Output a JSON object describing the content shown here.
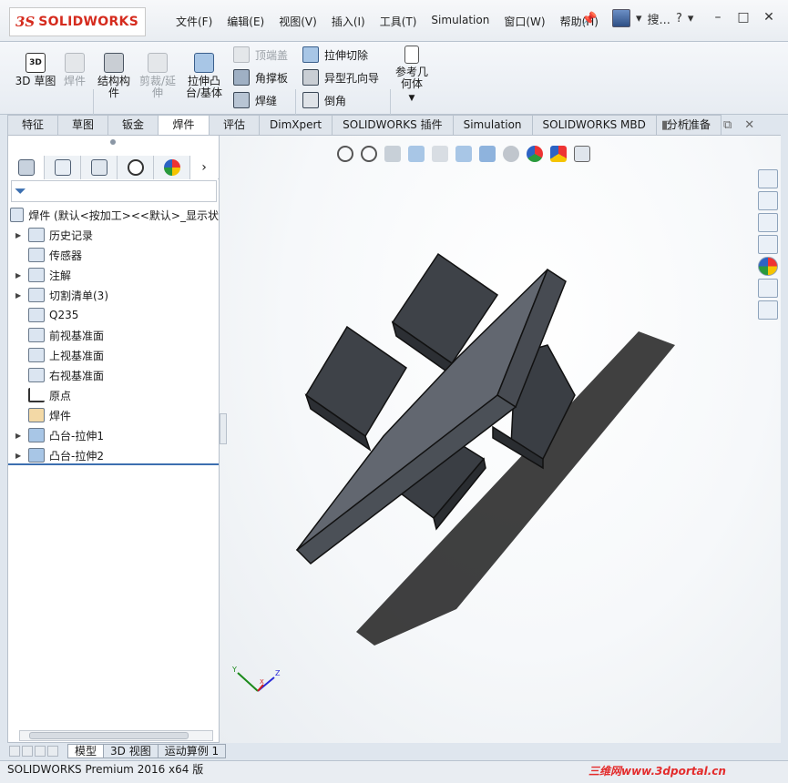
{
  "titlebar": {
    "logo_prefix": "3S",
    "logo_text": "SOLIDWORKS",
    "menus": [
      "文件(F)",
      "编辑(E)",
      "视图(V)",
      "插入(I)",
      "工具(T)",
      "Simulation",
      "窗口(W)",
      "帮助(H)"
    ],
    "right_label": "搜...",
    "help": "?"
  },
  "command_manager": {
    "left_buttons": [
      {
        "label": "3D 草图",
        "disabled": false
      },
      {
        "label": "焊件",
        "disabled": true
      },
      {
        "label": "结构构件",
        "disabled": false
      },
      {
        "label": "剪裁/延伸",
        "disabled": true
      },
      {
        "label": "拉伸凸台/基体",
        "disabled": false
      }
    ],
    "col1": [
      {
        "label": "顶端盖",
        "disabled": true
      },
      {
        "label": "角撑板",
        "disabled": false
      },
      {
        "label": "焊缝",
        "disabled": false
      }
    ],
    "col2": [
      {
        "label": "拉伸切除",
        "disabled": false
      },
      {
        "label": "异型孔向导",
        "disabled": false
      },
      {
        "label": "倒角",
        "disabled": false
      }
    ],
    "ref_geometry": "参考几何体"
  },
  "tabs": [
    "特征",
    "草图",
    "钣金",
    "焊件",
    "评估",
    "DimXpert",
    "SOLIDWORKS 插件",
    "Simulation",
    "SOLIDWORKS MBD",
    "分析准备"
  ],
  "active_tab": "焊件",
  "tree": {
    "root": "焊件  (默认<按加工><<默认>_显示状",
    "items": [
      {
        "label": "历史记录",
        "arrow": true
      },
      {
        "label": "传感器",
        "arrow": false
      },
      {
        "label": "注解",
        "arrow": true
      },
      {
        "label": "切割清单(3)",
        "arrow": true
      },
      {
        "label": "Q235",
        "arrow": false
      },
      {
        "label": "前视基准面",
        "arrow": false
      },
      {
        "label": "上视基准面",
        "arrow": false
      },
      {
        "label": "右视基准面",
        "arrow": false
      },
      {
        "label": "原点",
        "arrow": false
      },
      {
        "label": "焊件",
        "arrow": false
      },
      {
        "label": "凸台-拉伸1",
        "arrow": true
      },
      {
        "label": "凸台-拉伸2",
        "arrow": true
      }
    ]
  },
  "triad": {
    "x": "X",
    "y": "Y",
    "z": "Z"
  },
  "bottom_tabs": [
    "模型",
    "3D 视图",
    "运动算例 1"
  ],
  "status": "SOLIDWORKS Premium 2016 x64 版",
  "watermark": "三维网www.3dportal.cn",
  "colors": {
    "accent": "#d52b1e",
    "model": "#5a5f66",
    "selection": "#3c6fb0"
  }
}
